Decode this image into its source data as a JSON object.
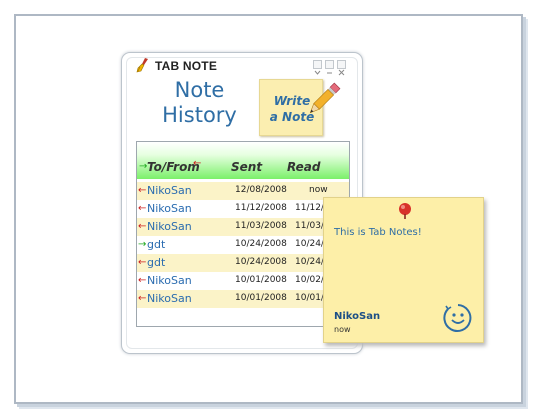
{
  "app": {
    "title": "TAB NOTE"
  },
  "heading": {
    "line1": "Note",
    "line2": "History"
  },
  "write_note": {
    "line1": "Write",
    "line2": "a Note"
  },
  "columns": {
    "to_from": "To/From",
    "sent": "Sent",
    "read": "Read"
  },
  "rows": [
    {
      "direction": "incoming",
      "name": "NikoSan",
      "sent": "12/08/2008",
      "read": "now"
    },
    {
      "direction": "incoming",
      "name": "NikoSan",
      "sent": "11/12/2008",
      "read": "11/12/2"
    },
    {
      "direction": "incoming",
      "name": "NikoSan",
      "sent": "11/03/2008",
      "read": "11/03/2"
    },
    {
      "direction": "outgoing",
      "name": "gdt",
      "sent": "10/24/2008",
      "read": "10/24/2"
    },
    {
      "direction": "incoming",
      "name": "gdt",
      "sent": "10/24/2008",
      "read": "10/24/2"
    },
    {
      "direction": "incoming",
      "name": "NikoSan",
      "sent": "10/01/2008",
      "read": "10/02/2"
    },
    {
      "direction": "incoming",
      "name": "NikoSan",
      "sent": "10/01/2008",
      "read": "10/01/2"
    }
  ],
  "sticky": {
    "message": "This is Tab Notes!",
    "author": "NikoSan",
    "time": "now"
  },
  "colors": {
    "accent_blue": "#2f6ea5",
    "note_yellow": "#fdefa8",
    "header_green": "#7bf06a",
    "incoming_arrow": "#cc2222",
    "outgoing_arrow": "#22aa22"
  },
  "icons": {
    "logo": "broom-icon",
    "write": "pencil-icon",
    "pin": "pushpin-icon",
    "mood": "smiley-icon"
  }
}
